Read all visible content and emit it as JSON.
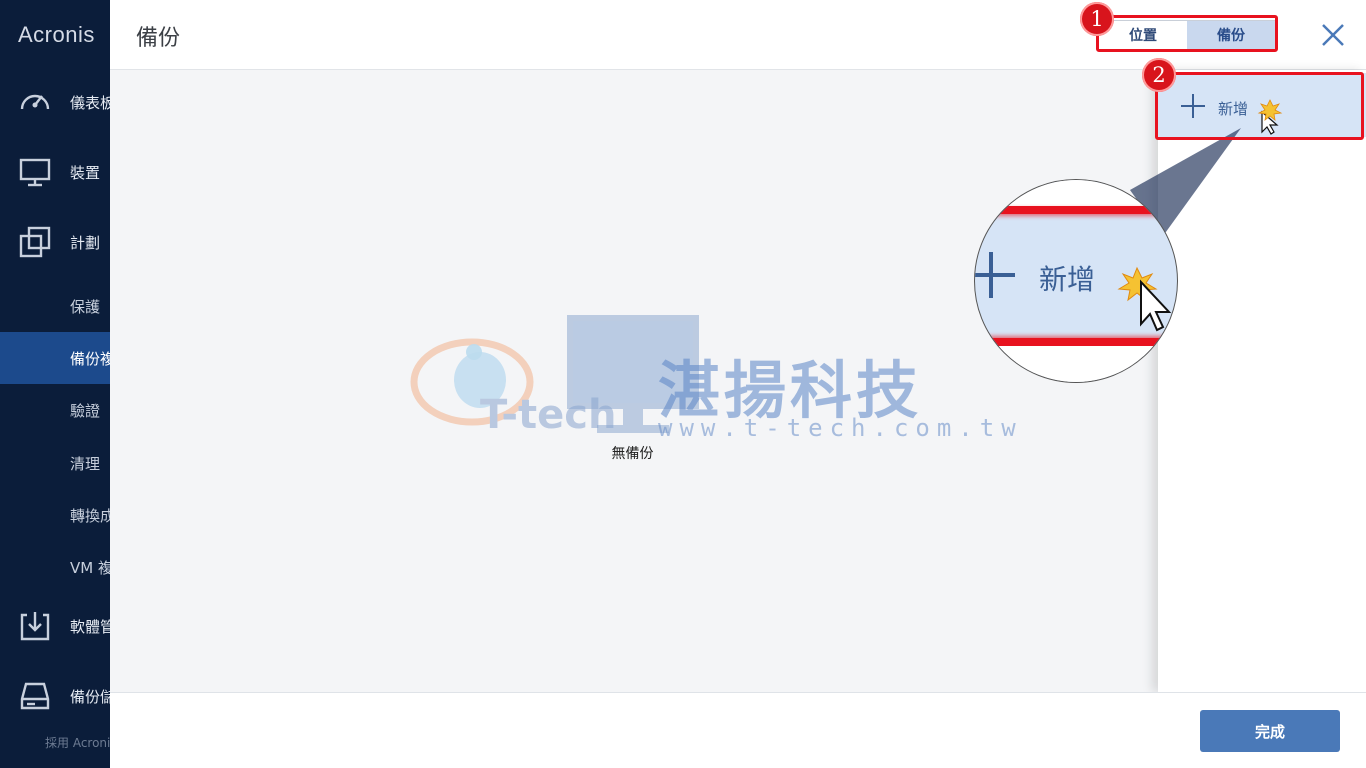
{
  "sidebar": {
    "brand": "Acronis",
    "main_items": [
      {
        "label": "儀表板",
        "icon": "dashboard-icon"
      },
      {
        "label": "裝置",
        "icon": "monitor-icon"
      },
      {
        "label": "計劃",
        "icon": "plans-icon"
      }
    ],
    "sub_items": [
      {
        "label": "保護",
        "active": false
      },
      {
        "label": "備份複",
        "active": true
      },
      {
        "label": "驗證",
        "active": false
      },
      {
        "label": "清理",
        "active": false
      },
      {
        "label": "轉換成",
        "active": false
      },
      {
        "label": "VM 複",
        "active": false
      }
    ],
    "bottom_items": [
      {
        "label": "軟體管",
        "icon": "download-icon"
      },
      {
        "label": "備份儲",
        "icon": "storage-icon"
      }
    ],
    "footer": "採用 Acronis"
  },
  "dialog": {
    "title": "備份",
    "toggle": {
      "left_label": "位置",
      "right_label": "備份",
      "selected": "備份"
    },
    "close_icon": "close-icon",
    "empty_text": "無備份",
    "add_label": "新增",
    "done_label": "完成"
  },
  "annotations": {
    "steps": [
      "1",
      "2"
    ],
    "magnifier_label": "新增",
    "highlight_color": "#e8121f"
  },
  "watermark": {
    "chinese": "湛揚科技",
    "brand": "T-tech",
    "url": "www.t-tech.com.tw"
  },
  "colors": {
    "sidebar_bg": "#0b1d3a",
    "active_item": "#1c4a8c",
    "accent": "#4a79b8",
    "selected_row": "#d6e4f6"
  }
}
